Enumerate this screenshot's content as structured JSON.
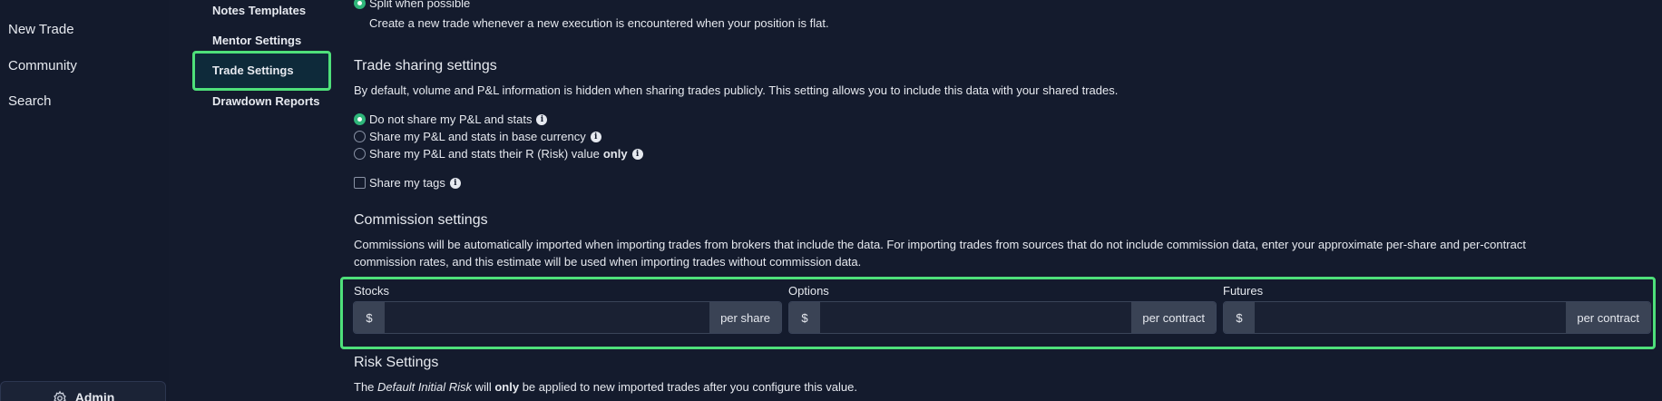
{
  "left_nav": {
    "items": [
      {
        "label": "New Trade"
      },
      {
        "label": "Community"
      },
      {
        "label": "Search"
      }
    ],
    "admin_label": "Admin"
  },
  "settings_nav": {
    "items": [
      {
        "label": "Notes Templates"
      },
      {
        "label": "Mentor Settings"
      },
      {
        "label": "Trade Settings",
        "active": true
      },
      {
        "label": "Drawdown Reports"
      }
    ]
  },
  "split": {
    "option_label": "Split when possible",
    "description": "Create a new trade whenever a new execution is encountered when your position is flat."
  },
  "trade_sharing": {
    "title": "Trade sharing settings",
    "description": "By default, volume and P&L information is hidden when sharing trades publicly. This setting allows you to include this data with your shared trades.",
    "options": [
      {
        "label": "Do not share my P&L and stats",
        "selected": true
      },
      {
        "label": "Share my P&L and stats in base currency",
        "selected": false
      },
      {
        "label": "Share my P&L and stats their R (Risk) value",
        "emphasis": "only",
        "selected": false
      }
    ],
    "share_tags_label": "Share my tags",
    "share_tags_checked": false
  },
  "commission": {
    "title": "Commission settings",
    "description_line1": "Commissions will be automatically imported when importing trades from brokers that include the data. For importing trades from sources that do not include commission data, enter your approximate per-share and per-contract",
    "description_line2": "commission rates, and this estimate will be used when importing trades without commission data.",
    "fields": [
      {
        "label": "Stocks",
        "prefix": "$",
        "value": "",
        "suffix": "per share"
      },
      {
        "label": "Options",
        "prefix": "$",
        "value": "",
        "suffix": "per contract"
      },
      {
        "label": "Futures",
        "prefix": "$",
        "value": "",
        "suffix": "per contract"
      }
    ]
  },
  "risk": {
    "title": "Risk Settings",
    "desc_the": "The ",
    "desc_em": "Default Initial Risk",
    "desc_will": " will ",
    "desc_only": "only",
    "desc_rest": " be applied to new imported trades after you configure this value."
  },
  "colors": {
    "background": "#141b2d",
    "highlight_border": "#4ee07a",
    "radio_selected": "#2fb67a"
  }
}
